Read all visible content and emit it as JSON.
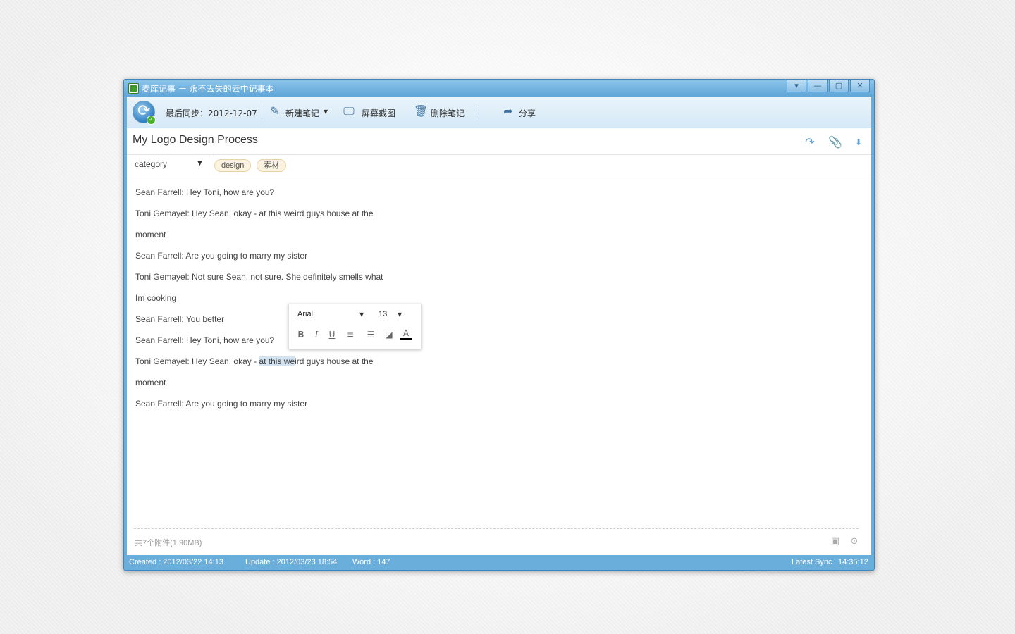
{
  "window": {
    "title": "麦库记事 － 永不丢失的云中记事本",
    "controls": [
      "▾",
      "—",
      "▢",
      "✕"
    ]
  },
  "toolbar": {
    "last_sync": "最后同步：2012-12-07",
    "new_note": "新建笔记",
    "screenshot": "屏幕截图",
    "delete_note": "删除笔记",
    "share": "分享"
  },
  "note": {
    "title": "My Logo Design Process",
    "category": "category",
    "tags": [
      "design",
      "素材"
    ]
  },
  "body": {
    "lines": [
      "Sean Farrell:  Hey Toni, how are you?",
      "Toni Gemayel:  Hey Sean, okay - at this weird guys house at the",
      "moment",
      "Sean Farrell:  Are you going to marry my sister",
      "Toni Gemayel:  Not sure Sean, not sure.  She definitely smells what",
      "Im cooking",
      "Sean Farrell:  You better",
      "Sean Farrell:  Hey Toni, how are you?",
      "moment",
      "Sean Farrell:  Are you going to marry my sister"
    ],
    "selected_line": {
      "before": "Toni Gemayel:  Hey Sean, okay - ",
      "selected": "at this we",
      "after": "ird guys house at the"
    }
  },
  "format_toolbar": {
    "font": "Arial",
    "size": "13",
    "bold": "B",
    "italic": "I",
    "underline": "U"
  },
  "attachments": {
    "summary": "共7个附件(1.90MB)"
  },
  "status": {
    "created": "Created : 2012/03/22  14:13",
    "updated": "Update : 2012/03/23 18:54",
    "words": "Word : 147",
    "latest_sync_label": "Latest Sync",
    "latest_sync_time": "14:35:12"
  },
  "colors": {
    "frame": "#6aaedc",
    "accent": "#2f7fc3",
    "tag_bg": "#fbf3e0",
    "selection": "#d3e3f2"
  }
}
